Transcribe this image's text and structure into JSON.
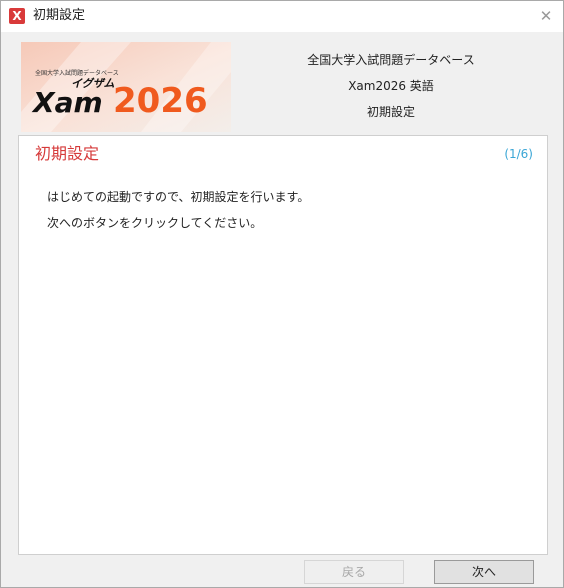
{
  "window": {
    "title": "初期設定",
    "app_icon_glyph": "X",
    "close_glyph": "✕"
  },
  "banner": {
    "caption": "全国大学入試問題データベース",
    "katakana": "イグザム",
    "logo_letters": "Xam",
    "logo_year": "2026"
  },
  "header": {
    "line1": "全国大学入試問題データベース",
    "line2": "Xam2026 英語",
    "line3": "初期設定"
  },
  "panel": {
    "title": "初期設定",
    "step": "(1/6)",
    "lines": [
      "はじめての起動ですので、初期設定を行います。",
      "次へのボタンをクリックしてください。"
    ]
  },
  "buttons": {
    "back_label": "戻る",
    "next_label": "次へ"
  },
  "colors": {
    "accent_red": "#d63a3a",
    "step_blue": "#3aa6d6",
    "logo_orange": "#f05a1e"
  }
}
